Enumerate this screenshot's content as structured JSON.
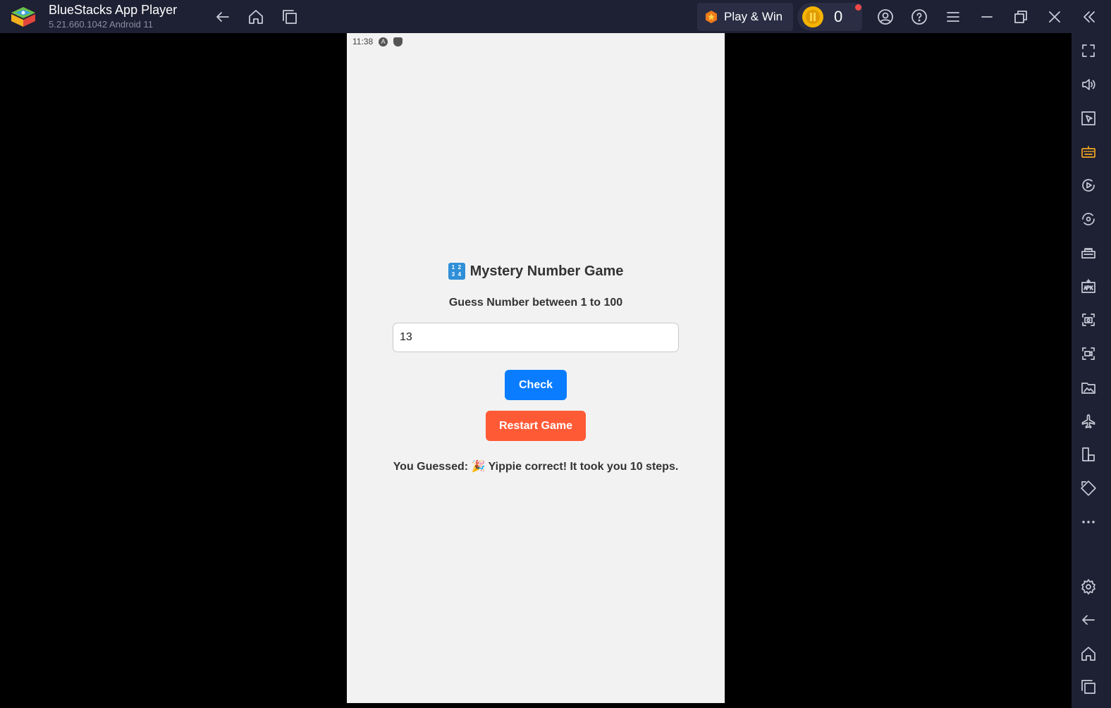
{
  "window": {
    "title": "BlueStacks App Player",
    "version": "5.21.660.1042  Android 11"
  },
  "toolbar": {
    "play_win_label": "Play & Win",
    "coin_count": "0"
  },
  "android": {
    "status_time": "11:38"
  },
  "game": {
    "title_emoji_digits": [
      "1",
      "2",
      "3",
      "4"
    ],
    "title": "Mystery Number Game",
    "subtitle": "Guess Number between 1 to 100",
    "input_value": "13",
    "check_label": "Check",
    "restart_label": "Restart Game",
    "result_text": "You Guessed: 🎉 Yippie correct! It took you 10 steps."
  },
  "colors": {
    "titlebar_bg": "#1e2033",
    "android_bg": "#f2f2f2",
    "check_button": "#0a7cff",
    "restart_button": "#ff5a36",
    "accent_dot": "#f04848",
    "coin": "#f5b400"
  },
  "icons": {
    "titlebar": [
      "back-arrow-icon",
      "home-icon",
      "recent-apps-icon",
      "account-icon",
      "help-icon",
      "menu-icon",
      "minimize-icon",
      "restore-icon",
      "close-icon",
      "collapse-sidebar-icon"
    ],
    "sidebar": [
      "fullscreen-icon",
      "volume-icon",
      "pointer-icon",
      "keyboard-icon",
      "macro-play-icon",
      "sync-icon",
      "game-controls-icon",
      "install-apk-icon",
      "screenshot-icon",
      "screen-record-icon",
      "media-folder-icon",
      "airplane-icon",
      "multi-instance-icon",
      "rotate-icon",
      "more-icon",
      "settings-icon",
      "back-icon",
      "home-icon",
      "recent-apps-icon"
    ]
  }
}
